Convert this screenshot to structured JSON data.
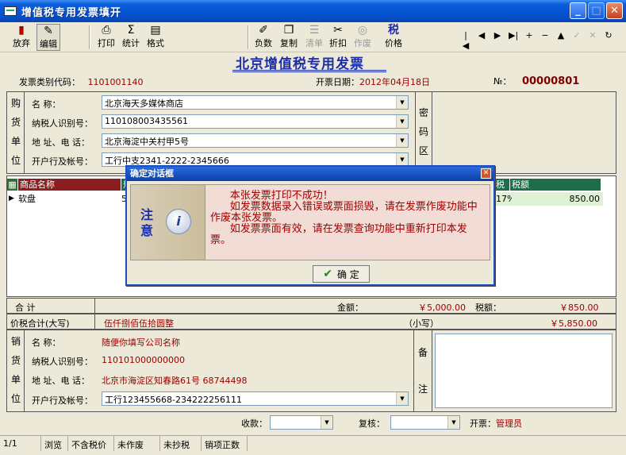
{
  "window": {
    "title": "增值税专用发票填开",
    "minimize": "_",
    "maximize": "□",
    "close": "✕"
  },
  "toolbar": {
    "buttons": [
      {
        "label": "放弃",
        "icon": "abandon-icon",
        "glyph": "▮"
      },
      {
        "label": "编辑",
        "icon": "edit-icon",
        "glyph": "✎"
      },
      {
        "label": "打印",
        "icon": "printer-icon",
        "glyph": "⎙"
      },
      {
        "label": "统计",
        "icon": "sigma-icon",
        "glyph": "Σ"
      },
      {
        "label": "格式",
        "icon": "format-icon",
        "glyph": "▤"
      },
      {
        "label": "负数",
        "icon": "negative-icon",
        "glyph": "✐"
      },
      {
        "label": "复制",
        "icon": "copy-icon",
        "glyph": "❐"
      },
      {
        "label": "清单",
        "icon": "list-icon",
        "glyph": "☰"
      },
      {
        "label": "折扣",
        "icon": "discount-icon",
        "glyph": "✂"
      },
      {
        "label": "作废",
        "icon": "void-icon",
        "glyph": "◎"
      },
      {
        "label": "价格",
        "icon": "price-icon",
        "glyph": "税"
      }
    ],
    "nav": [
      "|◀",
      "◀",
      "▶",
      "▶|",
      "+",
      "−",
      "▲",
      "✓",
      "✕",
      "↻"
    ]
  },
  "invoice": {
    "title": "北京增值税专用发票",
    "code_label": "发票类别代码：",
    "code_value": "1101001140",
    "date_label": "开票日期：",
    "date_value": "2012年04月18日",
    "no_label": "№：",
    "no_value": "00000801"
  },
  "buyer": {
    "side": [
      "购",
      "货",
      "单",
      "位"
    ],
    "name_label": "名        称：",
    "name_value": "北京海天多媒体商店",
    "taxid_label": "纳税人识别号：",
    "taxid_value": "110108003435561",
    "addr_label": "地 址、电 话：",
    "addr_value": "北京海淀中关村甲5号",
    "bank_label": "开户行及帐号：",
    "bank_value": "工行中支2341-2222-2345666",
    "cipher": [
      "密",
      "码",
      "区"
    ]
  },
  "grid": {
    "headers": [
      "商品名称",
      "规",
      "税率",
      "税额"
    ],
    "rows": [
      {
        "name": "软盘",
        "spec": "5",
        "rate": "17%",
        "tax": "850.00"
      }
    ]
  },
  "dialog": {
    "title": "确定对话框",
    "close": "✕",
    "note": "注意",
    "icon": "i",
    "message": "      本张发票打印不成功！\n      如发票数据录入错误或票面损毁，请在发票作废功能中作废本张发票。\n      如发票票面有效，请在发票查询功能中重新打印本发票。",
    "ok": "确 定"
  },
  "totals": {
    "sum_label": "合          计",
    "amount_label": "金额：",
    "amount_value": "￥5,000.00",
    "tax_label": "税额：",
    "tax_value": "￥850.00",
    "big_label": "价税合计(大写)",
    "big_value": "伍仟捌佰伍拾圆整",
    "small_label": "（小写）",
    "small_value": "￥5,850.00"
  },
  "seller": {
    "side": [
      "销",
      "货",
      "单",
      "位"
    ],
    "name_label": "名        称：",
    "name_value": "随便你填写公司名称",
    "taxid_label": "纳税人识别号：",
    "taxid_value": "110101000000000",
    "addr_label": "地 址、电 话：",
    "addr_value": "北京市海淀区知春路61号 68744498",
    "bank_label": "开户行及帐号：",
    "bank_value": "工行123455668-234222256111",
    "remark": [
      "备",
      "注"
    ]
  },
  "footer": {
    "payee_label": "收款：",
    "payee_value": "",
    "reviewer_label": "复核：",
    "reviewer_value": "",
    "issuer_label": "开票：",
    "issuer_value": "管理员"
  },
  "status": [
    "1/1",
    "浏览",
    "不含税价",
    "未作废",
    "未抄税",
    "销项正数"
  ]
}
